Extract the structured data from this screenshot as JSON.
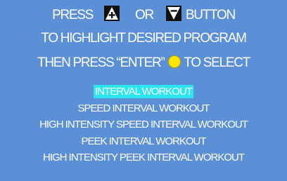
{
  "instructions": {
    "line1": {
      "press": "PRESS",
      "or": "OR",
      "button": "BUTTON",
      "up_icon": "up-arrow-button-icon",
      "down_icon": "down-arrow-button-icon"
    },
    "line2": "TO HIGHLIGHT DESIRED PROGRAM",
    "line3": {
      "before": "THEN PRESS “ENTER”",
      "after": "TO SELECT",
      "enter_icon": "yellow-enter-button-icon"
    }
  },
  "programs": [
    {
      "label": "INTERVAL WORKOUT",
      "selected": true
    },
    {
      "label": "SPEED INTERVAL WORKOUT",
      "selected": false
    },
    {
      "label": "HIGH INTENSITY SPEED INTERVAL WORKOUT",
      "selected": false
    },
    {
      "label": "PEEK INTERVAL WORKOUT",
      "selected": false
    },
    {
      "label": "HIGH INTENSITY PEEK INTERVAL WORKOUT",
      "selected": false
    }
  ],
  "colors": {
    "background": "#5b8fd6",
    "text": "#ffffff",
    "highlight": "#29e6ef",
    "enter_button": "#ffe500"
  }
}
